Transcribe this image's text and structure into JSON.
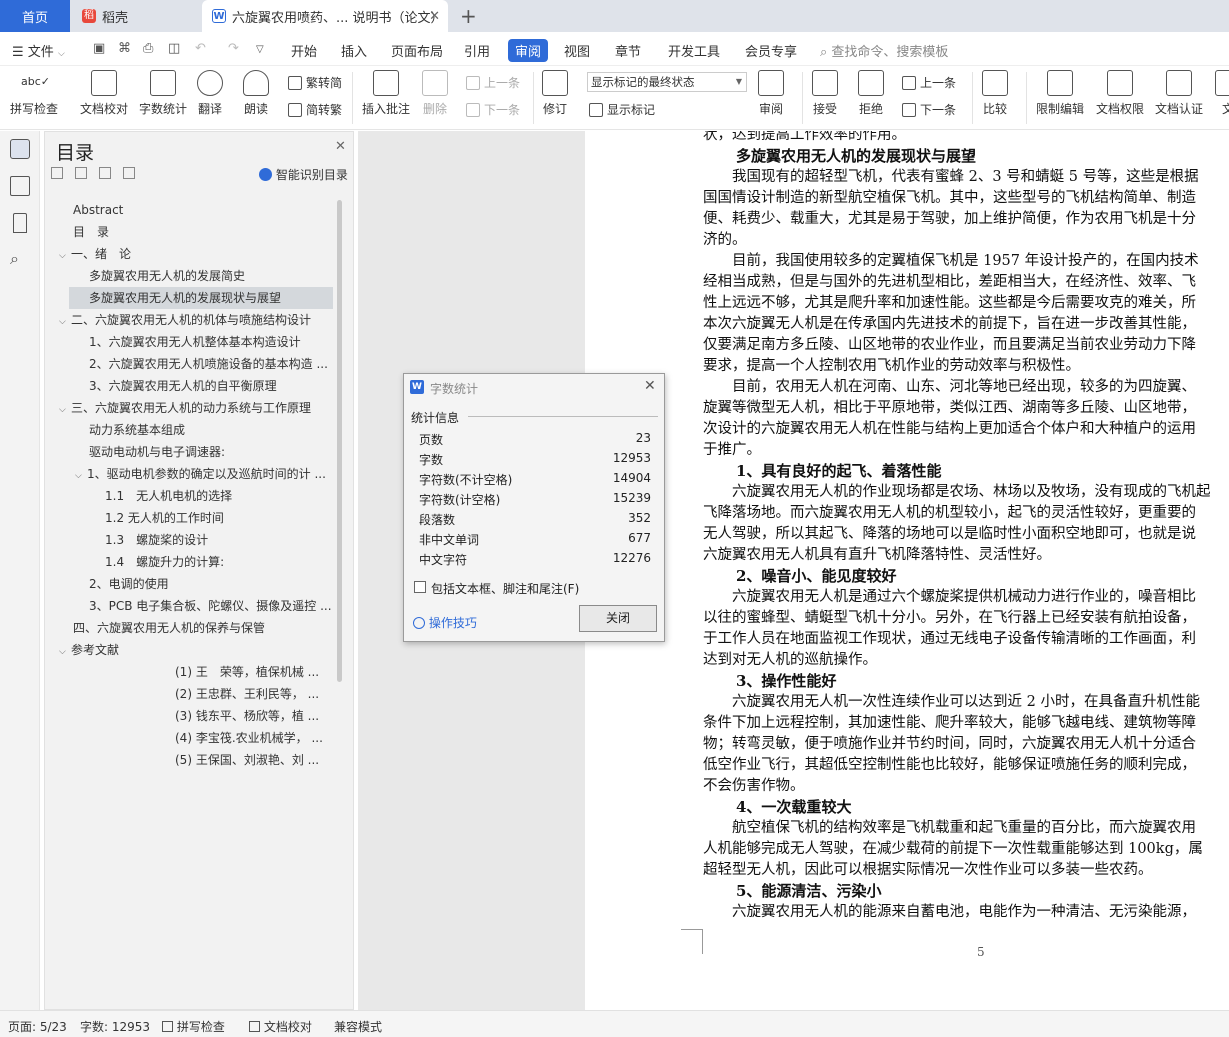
{
  "tabs": {
    "home": "首页",
    "daoke": "稻壳",
    "doc": "六旋翼农用喷药、... 说明书（论文）"
  },
  "menu": {
    "file": "文件",
    "items": [
      "开始",
      "插入",
      "页面布局",
      "引用",
      "审阅",
      "视图",
      "章节",
      "开发工具",
      "会员专享"
    ],
    "active_index": 4,
    "search_placeholder": "查找命令、搜索模板"
  },
  "ribbon": {
    "spellcheck": "拼写检查",
    "doccheck": "文档校对",
    "wordcount": "字数统计",
    "translate": "翻译",
    "read": "朗读",
    "trad": "繁转简",
    "simp": "简转繁",
    "insert_comment": "插入批注",
    "delete": "删除",
    "prev": "上一条",
    "next": "下一条",
    "revise": "修订",
    "markup_state": "显示标记的最终状态",
    "show_markup": "显示标记",
    "review": "审阅",
    "accept": "接受",
    "reject": "拒绝",
    "prev2": "上一条",
    "next2": "下一条",
    "compare": "比较",
    "restrict": "限制编辑",
    "permission": "文档权限",
    "certify": "文档认证",
    "more": "文"
  },
  "toc": {
    "title": "目录",
    "smart": "智能识别目录",
    "items": [
      {
        "label": "Abstract"
      },
      {
        "label": "目　录"
      },
      {
        "label": "一、绪　论"
      },
      {
        "label": "多旋翼农用无人机的发展简史"
      },
      {
        "label": "多旋翼农用无人机的发展现状与展望"
      },
      {
        "label": "二、六旋翼农用无人机的机体与喷施结构设计"
      },
      {
        "label": "1、六旋翼农用无人机整体基本构造设计"
      },
      {
        "label": "2、六旋翼农用无人机喷施设备的基本构造 ..."
      },
      {
        "label": "3、六旋翼农用无人机的自平衡原理"
      },
      {
        "label": "三、六旋翼农用无人机的动力系统与工作原理"
      },
      {
        "label": "动力系统基本组成"
      },
      {
        "label": "驱动电动机与电子调速器:"
      },
      {
        "label": "1、驱动电机参数的确定以及巡航时间的计 ..."
      },
      {
        "label": "1.1　无人机电机的选择"
      },
      {
        "label": "1.2  无人机的工作时间"
      },
      {
        "label": "1.3　螺旋桨的设计"
      },
      {
        "label": "1.4　螺旋升力的计算:"
      },
      {
        "label": "2、电调的使用"
      },
      {
        "label": "3、PCB 电子集合板、陀螺仪、摄像及遥控 ..."
      },
      {
        "label": "四、六旋翼农用无人机的保养与保管"
      },
      {
        "label": "参考文献"
      },
      {
        "label": "(1)  王　荣等，植保机械 ..."
      },
      {
        "label": "(2)  王忠群、王利民等， ..."
      },
      {
        "label": "(3)  钱东平、杨欣等，植 ..."
      },
      {
        "label": "(4)  李宝筏.农业机械学， ..."
      },
      {
        "label": "(5)  王保国、刘淑艳、刘 ..."
      }
    ]
  },
  "document": {
    "lines": [
      "状，达到提高工作效率的作用。",
      "多旋翼农用无人机的发展现状与展望",
      "　　我国现有的超轻型飞机，代表有蜜蜂 2、3 号和蜻蜓 5 号等，这些是根据",
      "国国情设计制造的新型航空植保飞机。其中，这些型号的飞机结构简单、制造",
      "便、耗费少、载重大，尤其是易于驾驶，加上维护简便，作为农用飞机是十分",
      "济的。",
      "　　目前，我国使用较多的定翼植保飞机是 1957 年设计投产的，在国内技术",
      "经相当成熟，但是与国外的先进机型相比，差距相当大，在经济性、效率、飞",
      "性上远远不够，尤其是爬升率和加速性能。这些都是今后需要攻克的难关，所",
      "本次六旋翼无人机是在传承国内先进技术的前提下，旨在进一步改善其性能，",
      "仅要满足南方多丘陵、山区地带的农业作业，而且要满足当前农业劳动力下降",
      "要求，提高一个人控制农用飞机作业的劳动效率与积极性。",
      "　　目前，农用无人机在河南、山东、河北等地已经出现，较多的为四旋翼、",
      "旋翼等微型无人机，相比于平原地带，类似江西、湖南等多丘陵、山区地带，",
      "次设计的六旋翼农用无人机在性能与结构上更加适合个体户和大种植户的运用",
      "于推广。",
      "1、具有良好的起飞、着落性能",
      "　　六旋翼农用无人机的作业现场都是农场、林场以及牧场，没有现成的飞机起",
      "飞降落场地。而六旋翼农用无人机的机型较小，起飞的灵活性较好，更重要的",
      "无人驾驶，所以其起飞、降落的场地可以是临时性小面积空地即可，也就是说",
      "六旋翼农用无人机具有直升飞机降落特性、灵活性好。",
      "2、噪音小、能见度较好",
      "　　六旋翼农用无人机是通过六个螺旋桨提供机械动力进行作业的，噪音相比",
      "以往的蜜蜂型、蜻蜓型飞机十分小。另外，在飞行器上已经安装有航拍设备，",
      "于工作人员在地面监视工作现状，通过无线电子设备传输清晰的工作画面，利",
      "达到对无人机的巡航操作。",
      "3、操作性能好",
      "　　六旋翼农用无人机一次性连续作业可以达到近 2 小时，在具备直升机性能",
      "条件下加上远程控制，其加速性能、爬升率较大，能够飞越电线、建筑物等障",
      "物；转弯灵敏，便于喷施作业并节约时间，同时，六旋翼农用无人机十分适合",
      "低空作业飞行，其超低空控制性能也比较好，能够保证喷施任务的顺利完成，",
      "不会伤害作物。",
      "4、一次载重较大",
      "　　航空植保飞机的结构效率是飞机载重和起飞重量的百分比，而六旋翼农用",
      "人机能够完成无人驾驶，在减少载荷的前提下一次性载重能够达到 100kg，属",
      "超轻型无人机，因此可以根据实际情况一次性作业可以多装一些农药。",
      "5、能源清洁、污染小",
      "　　六旋翼农用无人机的能源来自蓄电池，电能作为一种清洁、无污染能源，"
    ],
    "page_number": "5"
  },
  "dialog": {
    "title": "字数统计",
    "section": "统计信息",
    "rows": [
      {
        "label": "页数",
        "value": "23"
      },
      {
        "label": "字数",
        "value": "12953"
      },
      {
        "label": "字符数(不计空格)",
        "value": "14904"
      },
      {
        "label": "字符数(计空格)",
        "value": "15239"
      },
      {
        "label": "段落数",
        "value": "352"
      },
      {
        "label": "非中文单词",
        "value": "677"
      },
      {
        "label": "中文字符",
        "value": "12276"
      }
    ],
    "checkbox": "包括文本框、脚注和尾注(F)",
    "tips": "操作技巧",
    "close": "关闭"
  },
  "status": {
    "page": "页面: 5/23",
    "words": "字数: 12953",
    "spell": "拼写检查",
    "proof": "文档校对",
    "compat": "兼容模式"
  },
  "colors": {
    "accent": "#2f6bd8",
    "daoke": "#e8483b"
  }
}
